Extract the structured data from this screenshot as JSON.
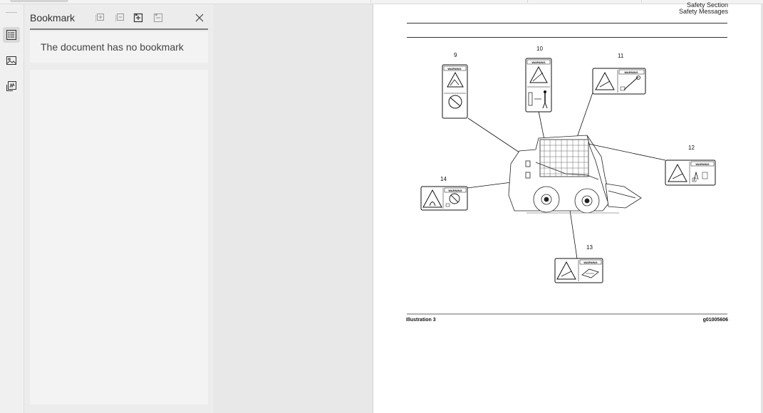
{
  "sidebar_panel": {
    "title": "Bookmark",
    "empty_message": "The document has no bookmark",
    "toolbar_icons": [
      "expand-all-icon",
      "collapse-all-icon",
      "add-bookmark-icon",
      "delete-bookmark-icon",
      "close-icon"
    ]
  },
  "left_rail": {
    "icons": [
      "bookmark-list-icon",
      "image-thumbnail-icon",
      "signature-icon"
    ],
    "active": "bookmark-list-icon"
  },
  "document_page": {
    "header_lines": [
      "Safety Section",
      "Safety Messages"
    ],
    "callouts": [
      {
        "label": "9",
        "sign": "WARNING"
      },
      {
        "label": "10",
        "sign": "WARNING"
      },
      {
        "label": "11",
        "sign": "WARNING"
      },
      {
        "label": "12",
        "sign": "WARNING"
      },
      {
        "label": "13",
        "sign": "WARNING"
      },
      {
        "label": "14",
        "sign": "WARNING"
      }
    ],
    "caption_left": "Illustration 3",
    "caption_right": "g01005606"
  }
}
